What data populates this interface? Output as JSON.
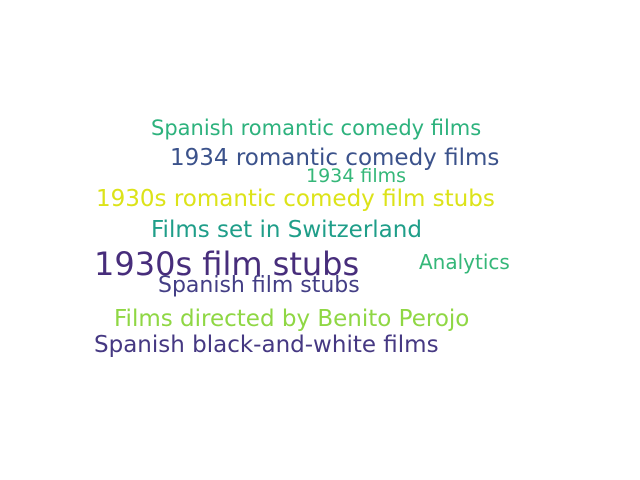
{
  "words": [
    {
      "text": "Spanish romantic comedy films",
      "color": "#2db27d"
    },
    {
      "text": "1934 romantic comedy films",
      "color": "#3b528b"
    },
    {
      "text": "1934 films",
      "color": "#35b779"
    },
    {
      "text": "1930s romantic comedy film stubs",
      "color": "#dce319"
    },
    {
      "text": "Films set in Switzerland",
      "color": "#1f9e89"
    },
    {
      "text": "1930s film stubs",
      "color": "#472d7b"
    },
    {
      "text": "Analytics",
      "color": "#35b779"
    },
    {
      "text": "Spanish film stubs",
      "color": "#433e85"
    },
    {
      "text": "Films directed by Benito Perojo",
      "color": "#8fd744"
    },
    {
      "text": "Spanish black-and-white films",
      "color": "#453882"
    }
  ]
}
